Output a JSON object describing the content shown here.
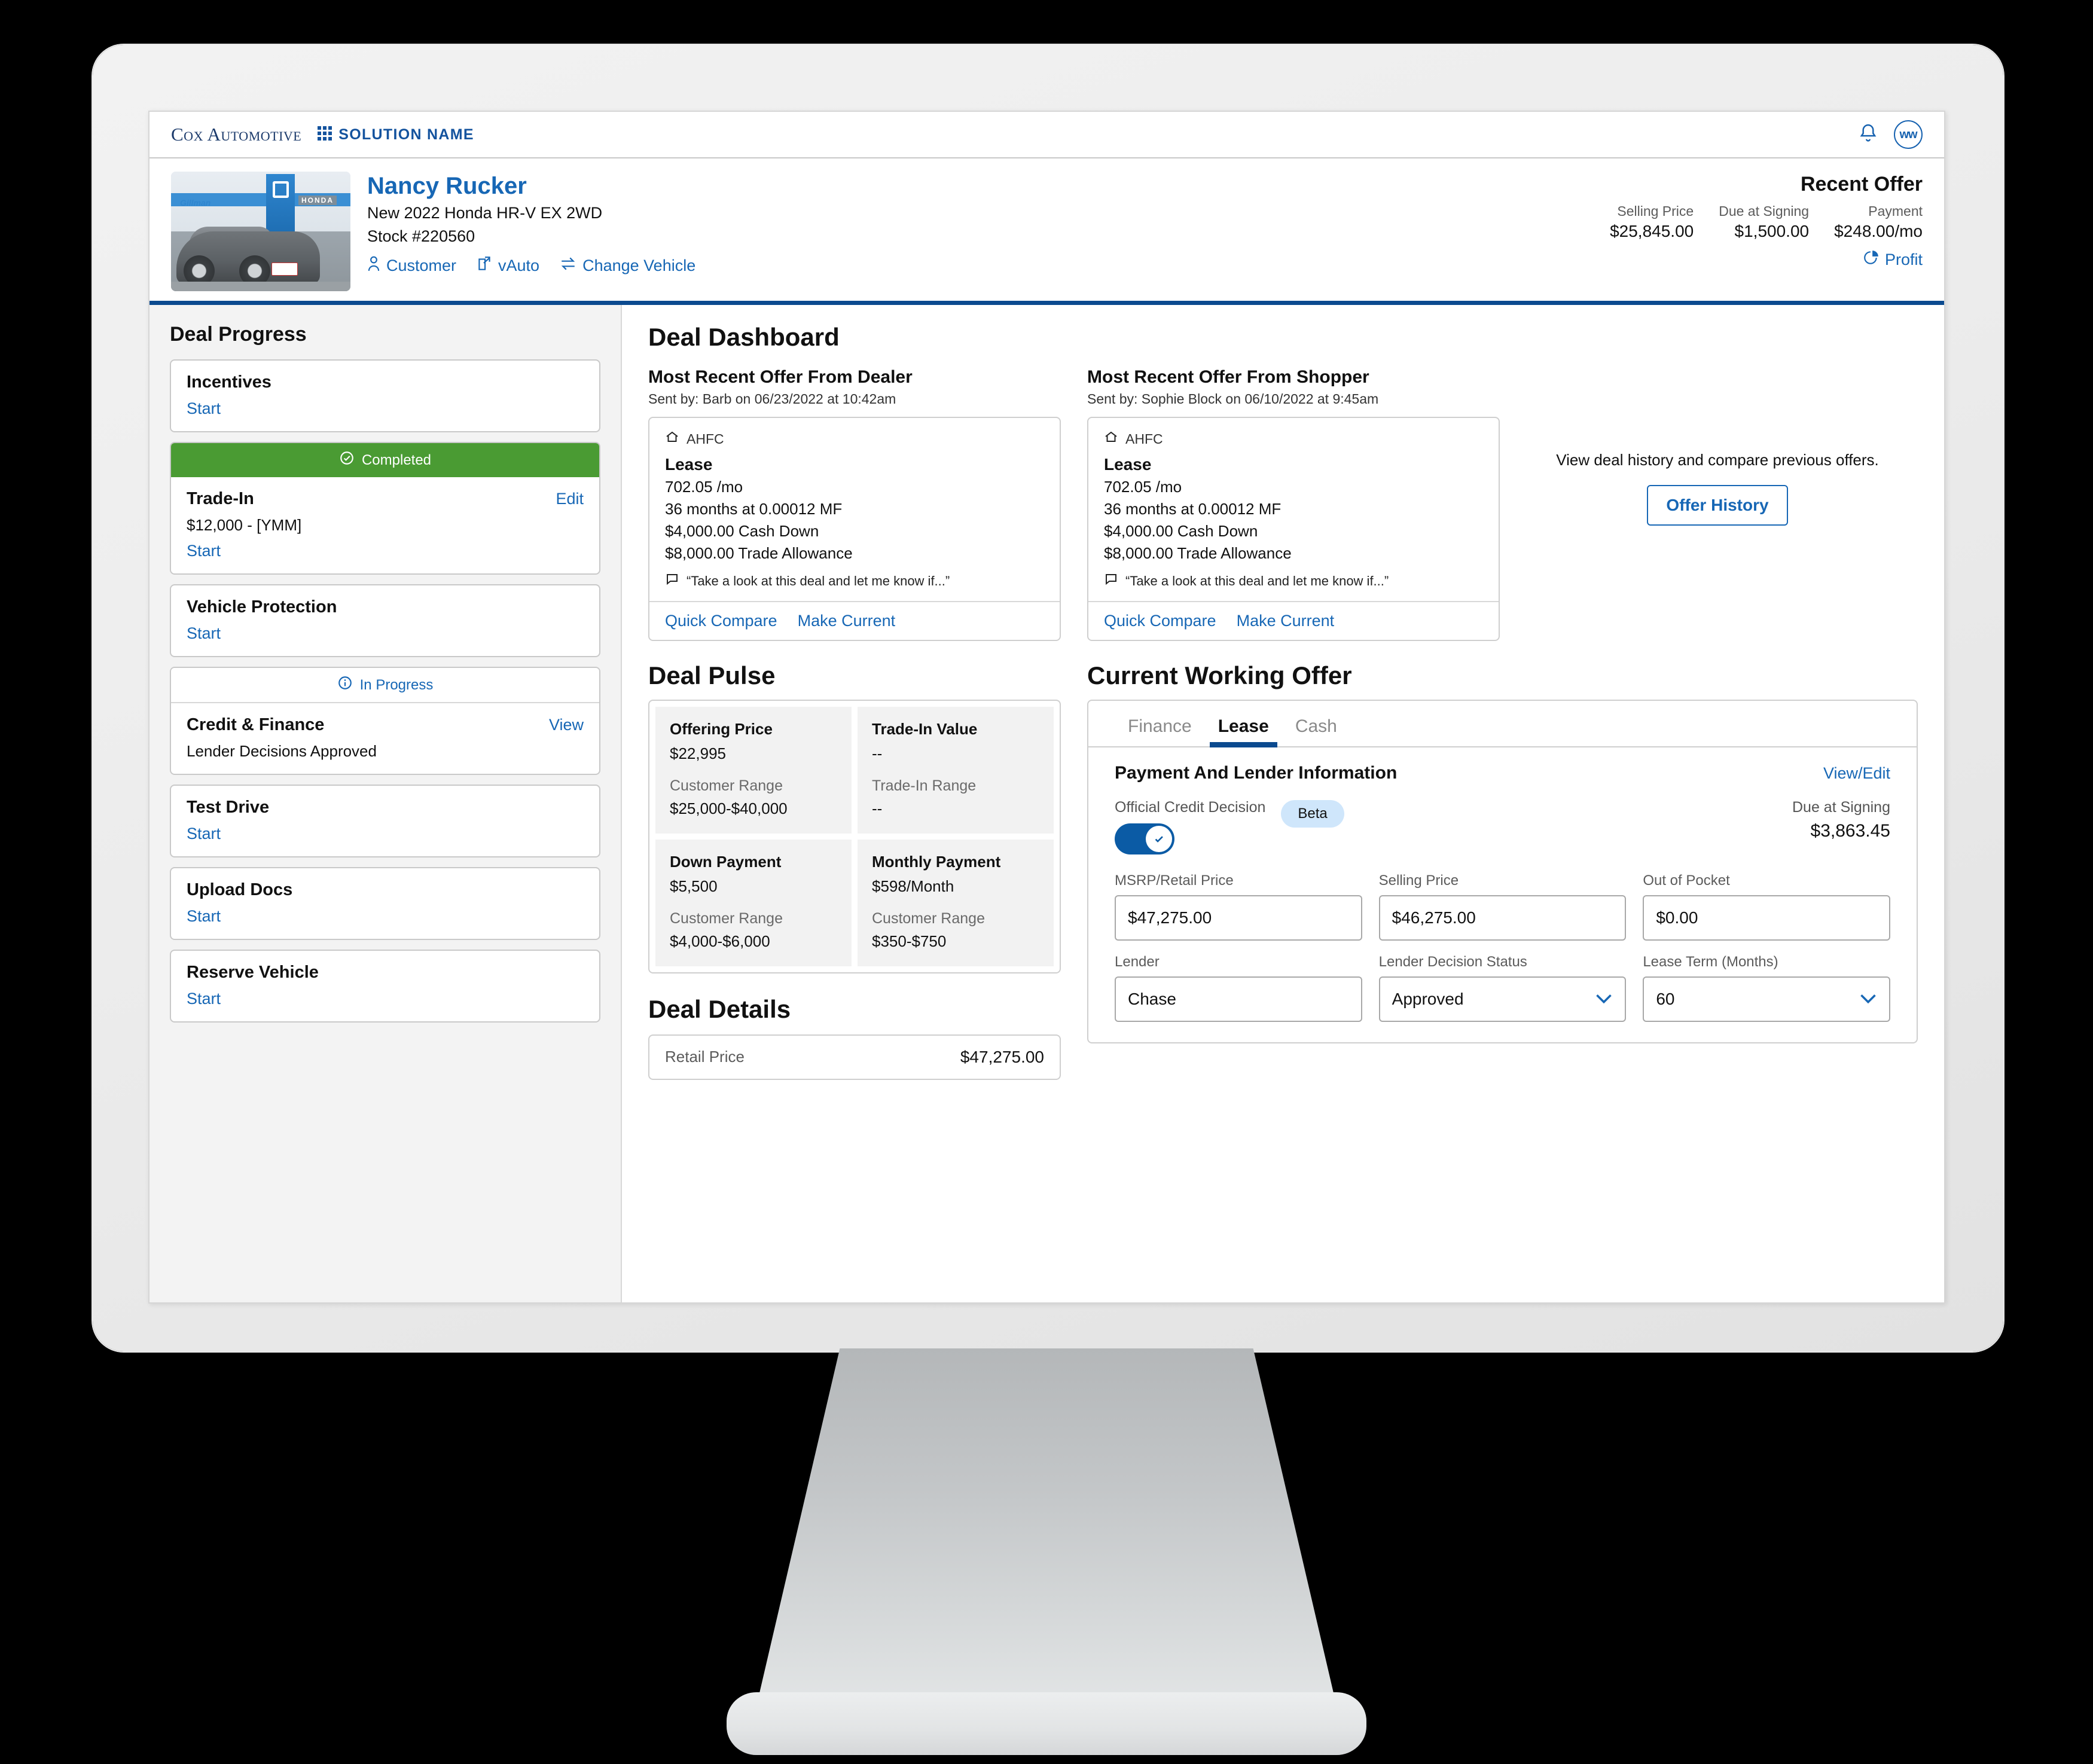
{
  "appbar": {
    "brand": "Cox Automotive",
    "solution_name": "SOLUTION NAME",
    "bell_icon": "bell-icon",
    "grid_icon": "grid-icon",
    "avatar_initials": "ww"
  },
  "vehicle_header": {
    "customer_name": "Nancy Rucker",
    "vehicle": "New 2022 Honda HR-V EX 2WD",
    "stock": "Stock #220560",
    "links": [
      {
        "label": "Customer",
        "icon": "person-icon"
      },
      {
        "label": "vAuto",
        "icon": "external-link-icon"
      },
      {
        "label": "Change Vehicle",
        "icon": "swap-arrows-icon"
      }
    ]
  },
  "offer_summary": {
    "title": "Recent Offer",
    "metrics": [
      {
        "label": "Selling Price",
        "value": "$25,845.00"
      },
      {
        "label": "Due at Signing",
        "value": "$1,500.00"
      },
      {
        "label": "Payment",
        "value": "$248.00/mo"
      }
    ],
    "profit_label": "Profit",
    "profit_icon": "pie-chart-icon"
  },
  "sidebar": {
    "title": "Deal Progress",
    "items": [
      {
        "status": null,
        "status_icon": null,
        "title": "Incentives",
        "action": null,
        "sub": null,
        "start": "Start"
      },
      {
        "status": "Completed",
        "status_icon": "check-circle-icon",
        "title": "Trade-In",
        "action": "Edit",
        "sub": "$12,000 - [YMM]",
        "start": "Start"
      },
      {
        "status": null,
        "status_icon": null,
        "title": "Vehicle Protection",
        "action": null,
        "sub": null,
        "start": "Start"
      },
      {
        "status": "In Progress",
        "status_icon": "info-circle-icon",
        "title": "Credit & Finance",
        "action": "View",
        "sub": "Lender Decisions Approved",
        "start": null
      },
      {
        "status": null,
        "status_icon": null,
        "title": "Test Drive",
        "action": null,
        "sub": null,
        "start": "Start"
      },
      {
        "status": null,
        "status_icon": null,
        "title": "Upload Docs",
        "action": null,
        "sub": null,
        "start": "Start"
      },
      {
        "status": null,
        "status_icon": null,
        "title": "Reserve Vehicle",
        "action": null,
        "sub": null,
        "start": "Start"
      }
    ]
  },
  "main": {
    "title": "Deal Dashboard",
    "dealer_offer": {
      "heading": "Most Recent Offer From Dealer",
      "sent_by": "Sent by: Barb on 06/23/2022 at 10:42am",
      "lender": "AHFC",
      "lender_icon": "home-icon",
      "type": "Lease",
      "lines": [
        "702.05 /mo",
        "36 months at 0.00012 MF",
        "$4,000.00 Cash Down",
        "$8,000.00 Trade Allowance"
      ],
      "quote": "“Take a look at this deal and let me know if...”",
      "quote_icon": "comment-icon",
      "actions": [
        "Quick Compare",
        "Make Current"
      ]
    },
    "shopper_offer": {
      "heading": "Most Recent Offer From Shopper",
      "sent_by": "Sent by: Sophie Block on 06/10/2022 at 9:45am",
      "lender": "AHFC",
      "lender_icon": "home-icon",
      "type": "Lease",
      "lines": [
        "702.05 /mo",
        "36 months at 0.00012 MF",
        "$4,000.00 Cash Down",
        "$8,000.00 Trade Allowance"
      ],
      "quote": "“Take a look at this deal and let me know if...”",
      "quote_icon": "comment-icon",
      "actions": [
        "Quick Compare",
        "Make Current"
      ]
    },
    "history": {
      "text": "View deal history and compare previous offers.",
      "button": "Offer History"
    },
    "deal_pulse": {
      "title": "Deal Pulse",
      "cells": [
        {
          "label": "Offering Price",
          "value": "$22,995",
          "range_label": "Customer Range",
          "range_value": "$25,000-$40,000"
        },
        {
          "label": "Trade-In Value",
          "value": "--",
          "range_label": "Trade-In Range",
          "range_value": "--"
        },
        {
          "label": "Down Payment",
          "value": "$5,500",
          "range_label": "Customer Range",
          "range_value": "$4,000-$6,000"
        },
        {
          "label": "Monthly Payment",
          "value": "$598/Month",
          "range_label": "Customer Range",
          "range_value": "$350-$750"
        }
      ]
    },
    "deal_details": {
      "title": "Deal Details",
      "rows": [
        {
          "label": "Retail Price",
          "value": "$47,275.00"
        }
      ]
    },
    "current_working_offer": {
      "title": "Current Working Offer",
      "tabs": [
        {
          "label": "Finance",
          "active": false
        },
        {
          "label": "Lease",
          "active": true
        },
        {
          "label": "Cash",
          "active": false
        }
      ],
      "section_title": "Payment And Lender Information",
      "view_edit": "View/Edit",
      "credit_label": "Official Credit Decision",
      "beta_badge": "Beta",
      "toggle_on": true,
      "toggle_icon": "check-icon",
      "due_label": "Due at Signing",
      "due_value": "$3,863.45",
      "fields": [
        {
          "label": "MSRP/Retail Price",
          "value": "$47,275.00",
          "type": "text"
        },
        {
          "label": "Selling Price",
          "value": "$46,275.00",
          "type": "text"
        },
        {
          "label": "Out of Pocket",
          "value": "$0.00",
          "type": "text"
        },
        {
          "label": "Lender",
          "value": "Chase",
          "type": "text"
        },
        {
          "label": "Lender Decision Status",
          "value": "Approved",
          "type": "select"
        },
        {
          "label": "Lease Term (Months)",
          "value": "60",
          "type": "select"
        }
      ]
    }
  },
  "colors": {
    "brand_blue": "#0b4a8f",
    "link_blue": "#1767b5",
    "status_green": "#4a9b33",
    "beta_blue": "#cfe6fb",
    "toggle_blue": "#0b5ba5"
  }
}
